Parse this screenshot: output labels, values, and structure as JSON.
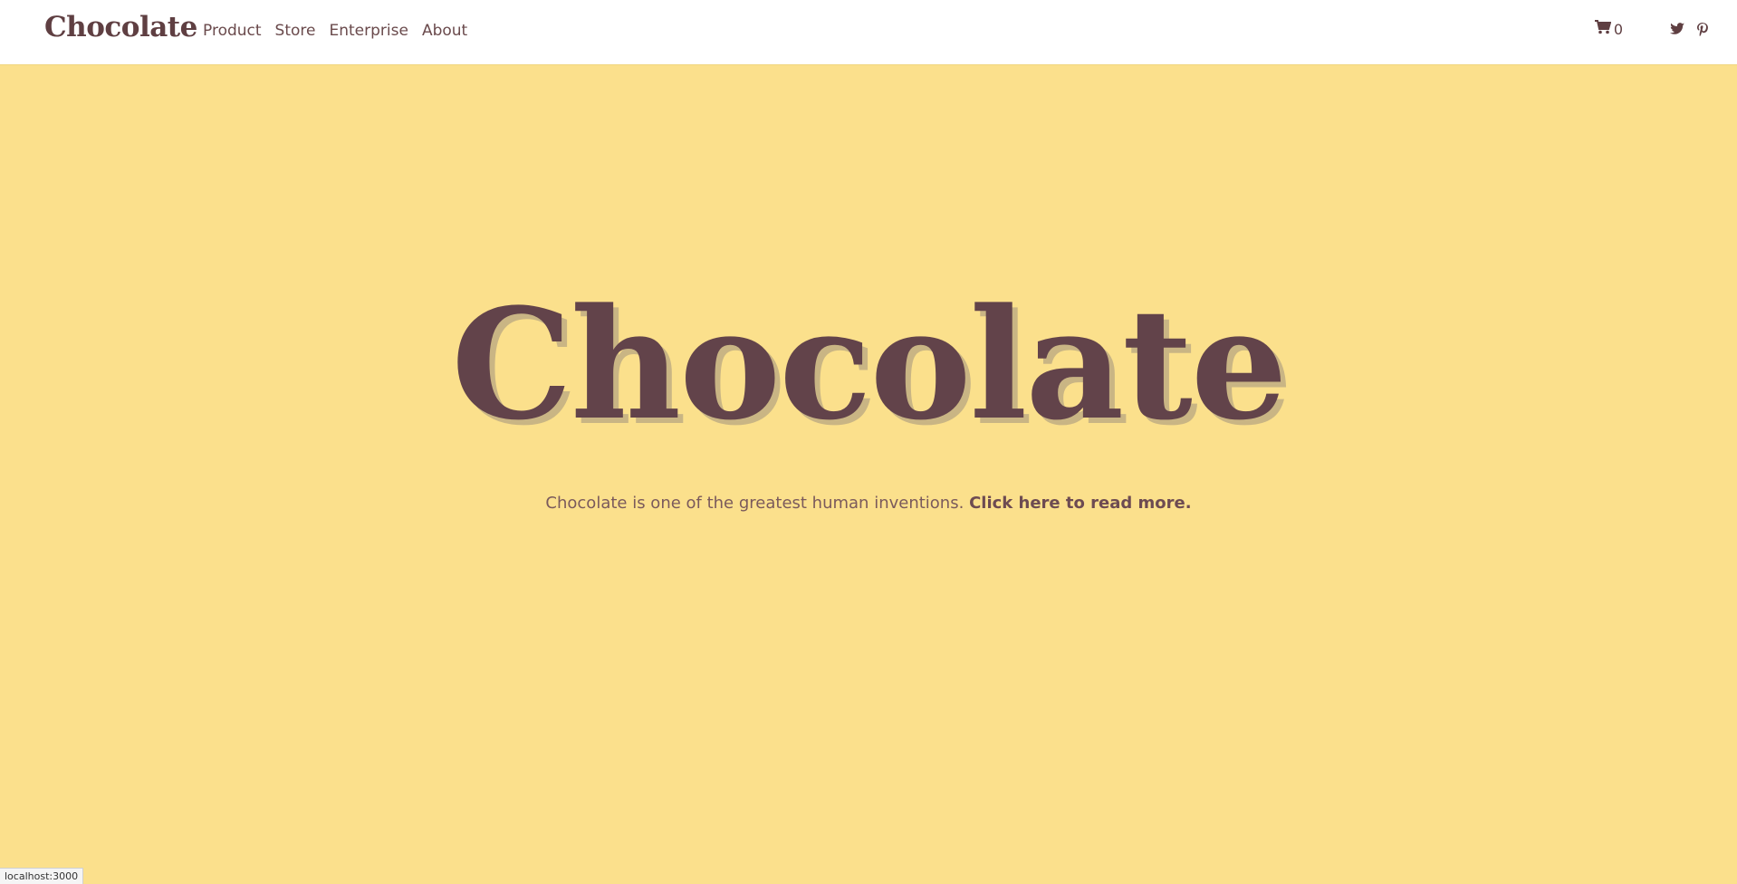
{
  "brand": {
    "name": "Chocolate"
  },
  "nav": {
    "items": [
      {
        "label": "Product"
      },
      {
        "label": "Store"
      },
      {
        "label": "Enterprise"
      },
      {
        "label": "About"
      }
    ]
  },
  "cart": {
    "icon": "cart-icon",
    "count": "0"
  },
  "social": {
    "twitter_icon": "twitter-icon",
    "pinterest_icon": "pinterest-icon"
  },
  "hero": {
    "title": "Chocolate",
    "subtitle": "Chocolate is one of the greatest human inventions.",
    "link_label": "Click here to read more."
  },
  "status_bar": {
    "url": "localhost:3000"
  },
  "colors": {
    "background": "#fbe08c",
    "navbar_bg": "#ffffff",
    "brand": "#5f3f42",
    "text": "#6a4a4c"
  }
}
